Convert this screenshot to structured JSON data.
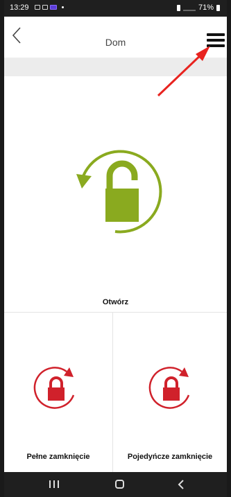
{
  "status_bar": {
    "time": "13:29",
    "battery": "71%"
  },
  "header": {
    "title": "Dom",
    "back_icon": "chevron-left-icon",
    "menu_icon": "hamburger-menu-icon"
  },
  "main_action": {
    "label": "Otwórz",
    "icon": "unlock-rotate-icon",
    "color": "#8aaa1f"
  },
  "secondary_actions": [
    {
      "label": "Pełne zamknięcie",
      "icon": "lock-rotate-icon",
      "color": "#d0212b"
    },
    {
      "label": "Pojedyńcze zamknięcie",
      "icon": "lock-rotate-icon",
      "color": "#d0212b"
    }
  ],
  "annotation": {
    "arrow_color": "#e8231f"
  },
  "nav_bar": {
    "recent_icon": "recent-apps-icon",
    "home_icon": "home-icon",
    "back_icon": "back-icon"
  }
}
